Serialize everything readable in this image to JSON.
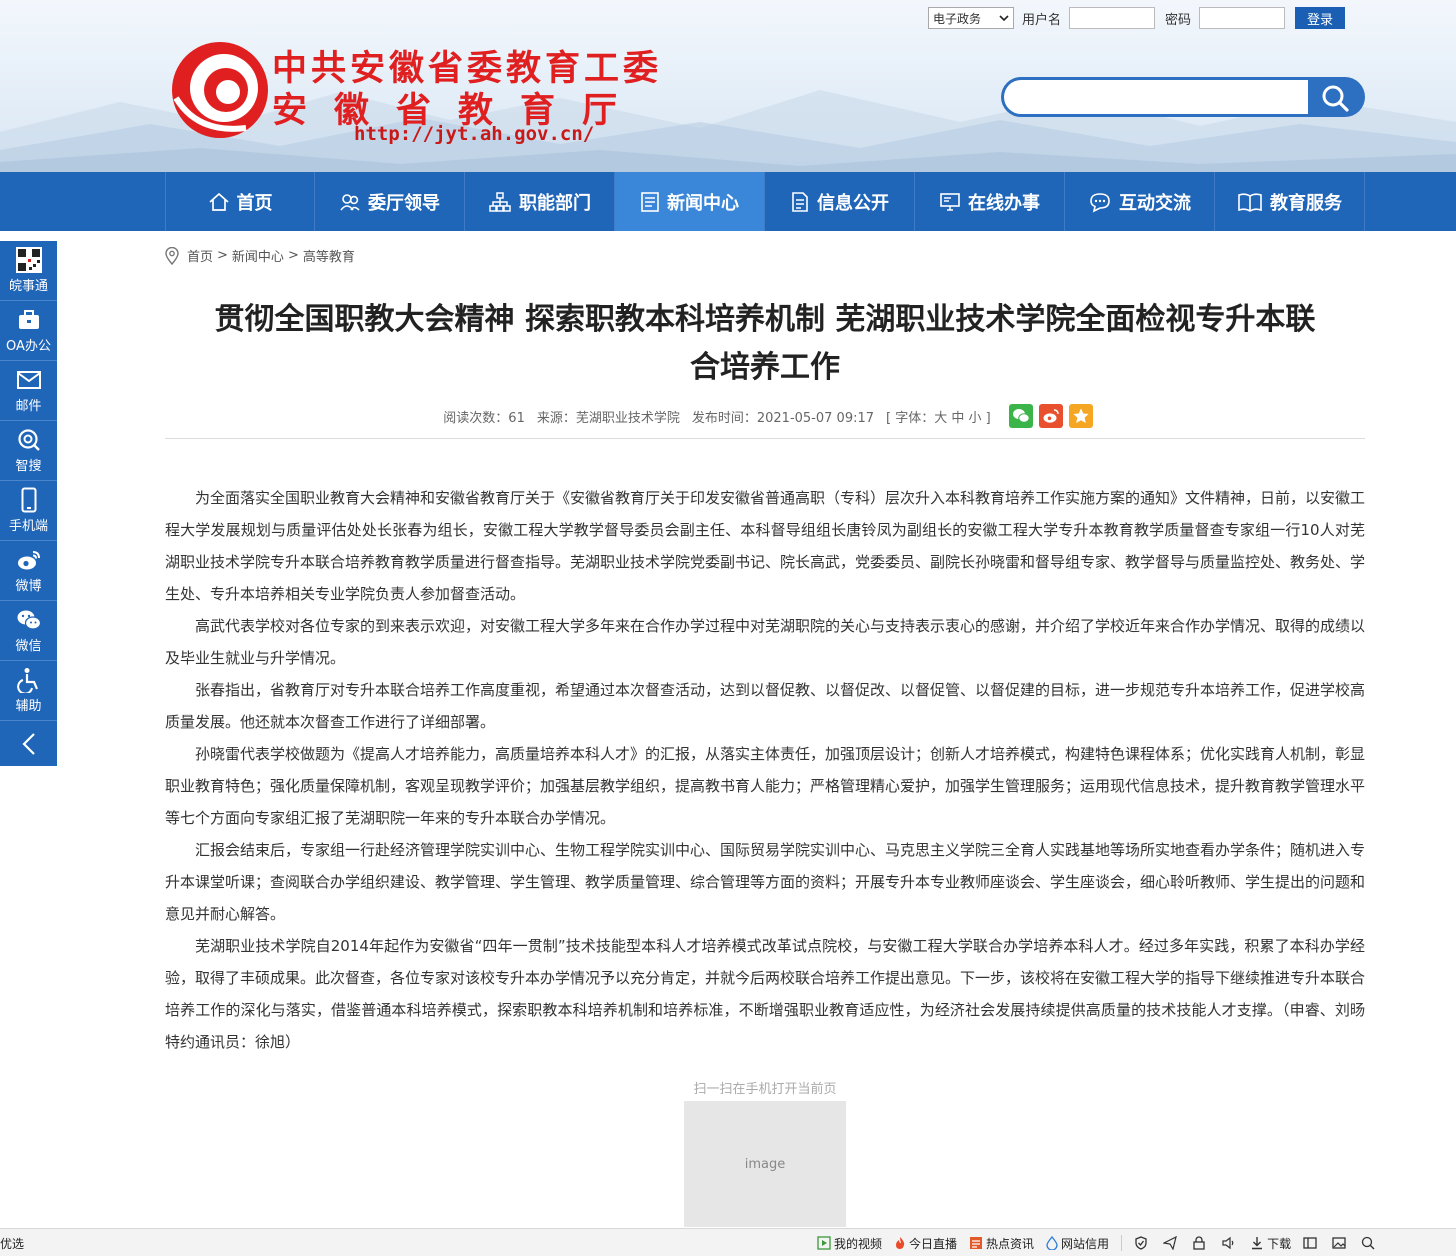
{
  "header": {
    "org_line1": "中共安徽省委教育工委",
    "org_line2": "安徽省教育厅",
    "url": "http://jyt.ah.gov.cn/",
    "login": {
      "system_select": "电子政务",
      "username_label": "用户名",
      "password_label": "密码",
      "login_button": "登录"
    }
  },
  "nav": {
    "items": [
      {
        "label": "首页",
        "icon": "home-icon"
      },
      {
        "label": "委厅领导",
        "icon": "leaders-icon"
      },
      {
        "label": "职能部门",
        "icon": "org-chart-icon"
      },
      {
        "label": "新闻中心",
        "icon": "news-icon",
        "active": true
      },
      {
        "label": "信息公开",
        "icon": "document-icon"
      },
      {
        "label": "在线办事",
        "icon": "monitor-icon"
      },
      {
        "label": "互动交流",
        "icon": "chat-icon"
      },
      {
        "label": "教育服务",
        "icon": "book-icon"
      }
    ]
  },
  "sidebar": {
    "items": [
      {
        "label": "皖事通",
        "icon": "qr-code-icon"
      },
      {
        "label": "OA办公",
        "icon": "briefcase-icon"
      },
      {
        "label": "邮件",
        "icon": "mail-icon"
      },
      {
        "label": "智搜",
        "icon": "smart-search-icon"
      },
      {
        "label": "手机端",
        "icon": "phone-icon"
      },
      {
        "label": "微博",
        "icon": "weibo-icon"
      },
      {
        "label": "微信",
        "icon": "wechat-icon"
      },
      {
        "label": "辅助",
        "icon": "accessibility-icon"
      }
    ],
    "back_icon": "chevron-left-icon"
  },
  "breadcrumb": [
    "首页",
    "新闻中心",
    "高等教育"
  ],
  "article": {
    "title_line1": "贯彻全国职教大会精神 探索职教本科培养机制 芜湖职业技术学院全面检视专升本联",
    "title_line2": "合培养工作",
    "meta": {
      "reads": "阅读次数：61",
      "source": "来源：芜湖职业技术学院",
      "published": "发布时间：2021-05-07 09:17",
      "font_size": "[ 字体：大 中 小 ]"
    },
    "paragraphs": [
      "为全面落实全国职业教育大会精神和安徽省教育厅关于《安徽省教育厅关于印发安徽省普通高职（专科）层次升入本科教育培养工作实施方案的通知》文件精神，日前，以安徽工程大学发展规划与质量评估处处长张春为组长，安徽工程大学教学督导委员会副主任、本科督导组组长唐铃凤为副组长的安徽工程大学专升本教育教学质量督查专家组一行10人对芜湖职业技术学院专升本联合培养教育教学质量进行督查指导。芜湖职业技术学院党委副书记、院长高武，党委委员、副院长孙晓雷和督导组专家、教学督导与质量监控处、教务处、学生处、专升本培养相关专业学院负责人参加督查活动。",
      "高武代表学校对各位专家的到来表示欢迎，对安徽工程大学多年来在合作办学过程中对芜湖职院的关心与支持表示衷心的感谢，并介绍了学校近年来合作办学情况、取得的成绩以及毕业生就业与升学情况。",
      "张春指出，省教育厅对专升本联合培养工作高度重视，希望通过本次督查活动，达到以督促教、以督促改、以督促管、以督促建的目标，进一步规范专升本培养工作，促进学校高质量发展。他还就本次督查工作进行了详细部署。",
      "孙晓雷代表学校做题为《提高人才培养能力，高质量培养本科人才》的汇报，从落实主体责任，加强顶层设计；创新人才培养模式，构建特色课程体系；优化实践育人机制，彰显职业教育特色；强化质量保障机制，客观呈现教学评价；加强基层教学组织，提高教书育人能力；严格管理精心爱护，加强学生管理服务；运用现代信息技术，提升教育教学管理水平等七个方面向专家组汇报了芜湖职院一年来的专升本联合办学情况。",
      "汇报会结束后，专家组一行赴经济管理学院实训中心、生物工程学院实训中心、国际贸易学院实训中心、马克思主义学院三全育人实践基地等场所实地查看办学条件；随机进入专升本课堂听课；查阅联合办学组织建设、教学管理、学生管理、教学质量管理、综合管理等方面的资料；开展专升本专业教师座谈会、学生座谈会，细心聆听教师、学生提出的问题和意见并耐心解答。",
      "芜湖职业技术学院自2014年起作为安徽省“四年一贯制”技术技能型本科人才培养模式改革试点院校，与安徽工程大学联合办学培养本科人才。经过多年实践，积累了本科办学经验，取得了丰硕成果。此次督查，各位专家对该校专升本办学情况予以充分肯定，并就今后两校联合培养工作提出意见。下一步，该校将在安徽工程大学的指导下继续推进专升本联合培养工作的深化与落实，借鉴普通本科培养模式，探索职教本科培养机制和培养标准，不断增强职业教育适应性，为经济社会发展持续提供高质量的技术技能人才支撑。（申睿、刘旸 特约通讯员：徐旭）"
    ],
    "qr_label": "扫一扫在手机打开当前页"
  },
  "statusbar": {
    "left": "优选",
    "items": [
      "我的视频",
      "今日直播",
      "热点资讯",
      "网站信用",
      "下载"
    ]
  },
  "colors": {
    "nav_blue": "#1f65b8",
    "nav_active": "#3a86d8",
    "logo_red": "#e02020"
  }
}
